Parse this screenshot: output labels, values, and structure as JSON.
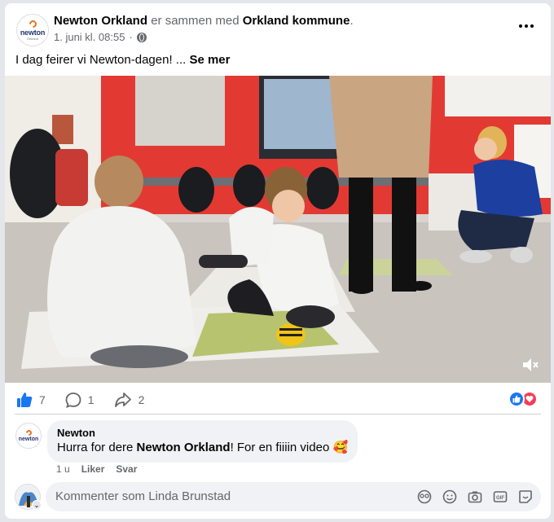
{
  "post": {
    "page_name": "Newton Orkland",
    "with_text": "er sammen med",
    "with_name": "Orkland kommune",
    "period": ".",
    "timestamp": "1. juni kl. 08:55",
    "text": "I dag feirer vi Newton-dagen! ...",
    "see_more": "Se mer",
    "avatar_logo": "newton",
    "avatar_sub": "Orkland"
  },
  "stats": {
    "likes": "7",
    "comments": "1",
    "shares": "2"
  },
  "comment": {
    "author": "Newton",
    "text_before": "Hurra for dere",
    "mention": "Newton Orkland",
    "text_after": "! For en fiiiin video 🥰",
    "time": "1 u",
    "like_label": "Liker",
    "reply_label": "Svar",
    "avatar_logo": "newton"
  },
  "composer": {
    "placeholder": "Kommenter som Linda Brunstad"
  },
  "colors": {
    "facebook_blue": "#1877f2",
    "love_red": "#f33e58",
    "newton_orange": "#e8711f",
    "newton_navy": "#24356f"
  },
  "icons": [
    "globe-icon",
    "more-icon",
    "like-icon",
    "comment-icon",
    "share-icon",
    "mute-icon",
    "avatar-icon",
    "emoji-icon",
    "camera-icon",
    "gif-icon",
    "sticker-icon"
  ]
}
